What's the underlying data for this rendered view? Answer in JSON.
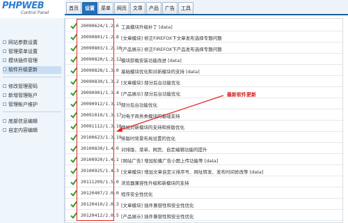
{
  "logo": {
    "title": "PHPWEB",
    "subtitle": "Control Panel"
  },
  "nav": {
    "tabs": [
      {
        "label": "首页",
        "active": false
      },
      {
        "label": "设置",
        "active": true
      },
      {
        "label": "菜单",
        "active": false
      },
      {
        "label": "网页",
        "active": false
      },
      {
        "label": "文章",
        "active": false
      },
      {
        "label": "产品",
        "active": false
      },
      {
        "label": "广告",
        "active": false
      },
      {
        "label": "工具",
        "active": false
      }
    ]
  },
  "sidebar": {
    "items": [
      {
        "label": "网站参数设置",
        "active": false
      },
      {
        "label": "管理菜单设置",
        "active": false
      },
      {
        "label": "模块插件管理",
        "active": false
      },
      {
        "label": "软件升级更新",
        "active": true
      },
      {
        "label": "修改管理密码",
        "active": false
      },
      {
        "label": "新增管理账户",
        "active": false
      },
      {
        "label": "管理帐户维护",
        "active": false
      },
      {
        "label": "底部信息编辑",
        "active": false
      },
      {
        "label": "自定内容编辑",
        "active": false
      }
    ]
  },
  "updates": [
    {
      "version": "20090624/1.2.6",
      "desc": "工具模块升级补丁  [data]"
    },
    {
      "version": "20090801/1.2.8",
      "desc": "[文章模块] 修正FIREFOX下文章发布选择专题问题"
    },
    {
      "version": "20090803/1.2.10",
      "desc": "[产品展示] 修正FIREFOX下产品发布选择专题问题"
    },
    {
      "version": "20090820/1.2.12",
      "desc": "模块卸载安装功能改进  [data]"
    },
    {
      "version": "20090828/1.3.0",
      "desc": "基础模块优化和对新模块的支持  [data]"
    },
    {
      "version": "20090830/1.3.2",
      "desc": "[文章模块]  部分后台功能优化"
    },
    {
      "version": "20090901/1.3.4",
      "desc": "[产品展示]  部分后台功能优化"
    },
    {
      "version": "20090912/1.3.15",
      "desc": "部分后台功能优化"
    },
    {
      "version": "20091010/1.3.17",
      "desc": "对电子商务类模块的基础支持"
    },
    {
      "version": "20091112/1.3.18",
      "desc": "增加对新模块的支持和排版优化"
    },
    {
      "version": "20100623/1.3.19",
      "desc": "排版时背景布局设置的优化"
    },
    {
      "version": "20100830/1.4.0",
      "desc": "对排版、菜单、网页、自定编辑功能的提升"
    },
    {
      "version": "20100920/1.4.1",
      "desc": "[网站广告]  增加轮播广告小图上传功能等  [data]"
    },
    {
      "version": "20100925/1.4.3",
      "desc": "[文章模块] 增加文章自定义排序号、网址转发、发布时间修改等  [data]"
    },
    {
      "version": "20111209/1.5.0",
      "desc": "浏览器兼容性升级和新模块的支持"
    },
    {
      "version": "20120407/2.0.0",
      "desc": "程序安全性优化"
    },
    {
      "version": "20120410/2.0.3",
      "desc": "[文章模块]  插件兼容性和安全性优化"
    },
    {
      "version": "20120412/2.0.5",
      "desc": "[产品展示]  插件兼容性和安全性优化"
    }
  ],
  "annotation": {
    "label": "最新软件更新"
  },
  "colors": {
    "accent": "#2570bd",
    "check": "#2e9e2e",
    "annotation": "#e52222"
  }
}
